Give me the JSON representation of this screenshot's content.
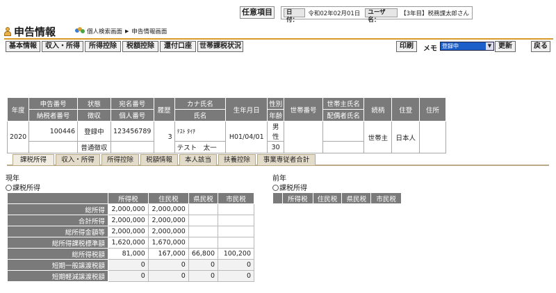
{
  "top": {
    "option_button": "任意項目",
    "date_label": "日付：",
    "date_value": "令和02年02月01日",
    "user_label": "ユーザ名：",
    "user_value": "【3年目】税務課太郎さん"
  },
  "title": {
    "text": "申告情報",
    "crumb1": "個人検索画面",
    "crumb_sep": "▶",
    "crumb2": "申告情報画面"
  },
  "buttons": {
    "basic": "基本情報",
    "income": "収入・所得",
    "deduction": "所得控除",
    "tax_deduction": "税額控除",
    "refund": "還付口座",
    "household": "世帯課税状況",
    "print": "印刷",
    "memo": "メモ",
    "memo_value": "登録中",
    "update": "更新",
    "back": "戻る"
  },
  "header": {
    "year": "年度",
    "report_no": "申告番号",
    "taxpayer_no": "納税者番号",
    "status": "状態",
    "collection": "徴収",
    "address_no": "宛名番号",
    "personal_no": "個人番号",
    "history": "履歴",
    "kana_name": "カナ氏名",
    "name": "氏名",
    "birth": "生年月日",
    "sex": "性別",
    "age": "年齢",
    "household_no": "世帯番号",
    "head_name": "世帯主氏名",
    "spouse_name": "配偶者氏名",
    "relation": "続柄",
    "residence": "住登",
    "address": "住所"
  },
  "record": {
    "year": "2020",
    "report_no": "100446",
    "taxpayer_no": "",
    "status": "登録中",
    "collection": "普通徴収",
    "address_no": "123456789",
    "personal_no": "",
    "history": "3",
    "kana_name": "ﾃｽﾄ ﾀｲﾁ",
    "name": "テスト　太一",
    "birth": "H01/04/01",
    "sex": "男性",
    "age": "30",
    "household_no": "",
    "head_name": "",
    "spouse_name": "",
    "relation": "世帯主",
    "residence": "日本人",
    "address": ""
  },
  "tabs": [
    "課税所得",
    "収入・所得",
    "所得控除",
    "税額情報",
    "本人該当",
    "扶養控除",
    "事業専従者合計"
  ],
  "current": {
    "year_label": "現年",
    "section_label": "課税所得",
    "columns": [
      "所得税",
      "住民税",
      "県民税",
      "市民税"
    ],
    "rows": [
      {
        "label": "総所得",
        "values": [
          "2,000,000",
          "2,000,000",
          "",
          ""
        ]
      },
      {
        "label": "合計所得",
        "values": [
          "2,000,000",
          "2,000,000",
          "",
          ""
        ]
      },
      {
        "label": "総所得金額等",
        "values": [
          "2,000,000",
          "2,000,000",
          "",
          ""
        ]
      },
      {
        "label": "総所得課税標準額",
        "values": [
          "1,620,000",
          "1,670,000",
          "",
          ""
        ]
      },
      {
        "label": "総所得税額",
        "values": [
          "81,000",
          "167,000",
          "66,800",
          "100,200"
        ]
      },
      {
        "label": "短期一般譲渡税額",
        "values": [
          "0",
          "0",
          "0",
          "0"
        ]
      },
      {
        "label": "短期軽減譲渡税額",
        "values": [
          "0",
          "0",
          "0",
          "0"
        ]
      }
    ]
  },
  "previous": {
    "year_label": "前年",
    "section_label": "課税所得",
    "columns": [
      "所得税",
      "住民税",
      "県民税",
      "市民税"
    ]
  }
}
